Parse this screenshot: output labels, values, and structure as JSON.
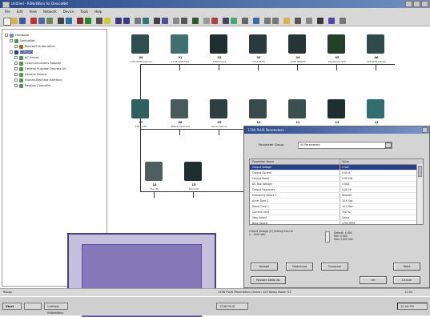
{
  "window": {
    "title": "Untitled - RSNetWorx for DeviceNet"
  },
  "menu": [
    "File",
    "Edit",
    "View",
    "Network",
    "Device",
    "Tools",
    "Help"
  ],
  "tree": {
    "items": [
      {
        "label": "Hardware",
        "indent": 0
      },
      {
        "label": "DeviceNet",
        "indent": 1
      },
      {
        "label": "Rockwell Automation",
        "indent": 2
      },
      {
        "label": "Category",
        "indent": 1
      },
      {
        "label": "AC Drives",
        "indent": 2
      },
      {
        "label": "Communications Adapter",
        "indent": 2
      },
      {
        "label": "General Purpose Discrete I/O",
        "indent": 2
      },
      {
        "label": "Generic Device",
        "indent": 2
      },
      {
        "label": "Human-Machine Interface",
        "indent": 2
      },
      {
        "label": "Position Controller",
        "indent": 2
      }
    ]
  },
  "devices": {
    "row1": [
      {
        "addr": "00",
        "name": "1747-SDN Scanner",
        "color": "#2f4f4f"
      },
      {
        "addr": "01",
        "name": "1794-ADN Flex",
        "color": "#3f6f6f"
      },
      {
        "addr": "02",
        "name": "1305 Drive",
        "color": "#1f2f2f"
      },
      {
        "addr": "03",
        "name": "1336 PLUS",
        "color": "#2a3a3a"
      },
      {
        "addr": "04",
        "name": "1336 IMPACT",
        "color": "#263636"
      },
      {
        "addr": "05",
        "name": "PanelView 550",
        "color": "#24402a"
      },
      {
        "addr": "06",
        "name": "193-EDN Starter",
        "color": "#2f4a4a"
      }
    ],
    "row2": [
      {
        "addr": "07",
        "name": "1203-GK5",
        "color": "#2f5f5f"
      },
      {
        "addr": "08",
        "name": "SMP-3 Overload",
        "color": "#4a5a5a"
      },
      {
        "addr": "09",
        "name": "Photo Sensor",
        "color": "#2f3f3f"
      },
      {
        "addr": "10",
        "name": "SMC Dialog Plus",
        "color": "#3a4a4a"
      },
      {
        "addr": "11",
        "name": "MCC Starter",
        "color": "#3a5050"
      },
      {
        "addr": "12",
        "name": "Ultra 100 Drive",
        "color": "#1f2f2f"
      },
      {
        "addr": "13",
        "name": "1794 I/O",
        "color": "#2f6f6f"
      }
    ],
    "row3": [
      {
        "addr": "14",
        "name": "Flex Ex",
        "color": "#4f5f5f"
      },
      {
        "addr": "15",
        "name": "Point I/O",
        "color": "#1f2f2f"
      }
    ]
  },
  "dialog": {
    "title": "1336 PLUS Parameters",
    "group_label": "Parameter Group:",
    "group_value": "All Parameters",
    "columns": [
      "Parameter Name",
      "Value"
    ],
    "rows": [
      {
        "name": "Output Voltage",
        "value": "0 VAC",
        "selected": true
      },
      {
        "name": "Output Current",
        "value": "0.00 A"
      },
      {
        "name": "Output Power",
        "value": "0.00 kW"
      },
      {
        "name": "DC Bus Voltage",
        "value": "0 VDC"
      },
      {
        "name": "Output Frequency",
        "value": "0.00 Hz"
      },
      {
        "name": "Frequency Select 1",
        "value": "Remote"
      },
      {
        "name": "Accel Time 1",
        "value": "10.0 Sec"
      },
      {
        "name": "Decel Time 1",
        "value": "10.0 Sec"
      },
      {
        "name": "Current Limit",
        "value": "150 %"
      },
      {
        "name": "Stop Select",
        "value": "Coast"
      },
      {
        "name": "Base Speed",
        "value": "1750 RPM"
      }
    ],
    "help": "Output Voltage (V) Setting from to\n0 - 1000 VAC",
    "help_values": "Default: 0 VAC\nMin: 0 VAC\nMax: 1000 VAC",
    "buttons_row1": [
      "Upload",
      "Download",
      "Compare",
      "Start"
    ],
    "buttons_row2": [
      "Restore Defaults",
      "OK",
      "Cancel"
    ]
  },
  "status": {
    "left": "Ready",
    "path": "1336 PLUS Parameters",
    "right": "Online: 125 Kbit/s  Node: 03",
    "time": "12:00"
  },
  "taskbar": {
    "start": "Start",
    "tasks": [
      "Untitled - RSNetWorx",
      "1336 PLUS"
    ],
    "clock": "12:00 PM"
  }
}
